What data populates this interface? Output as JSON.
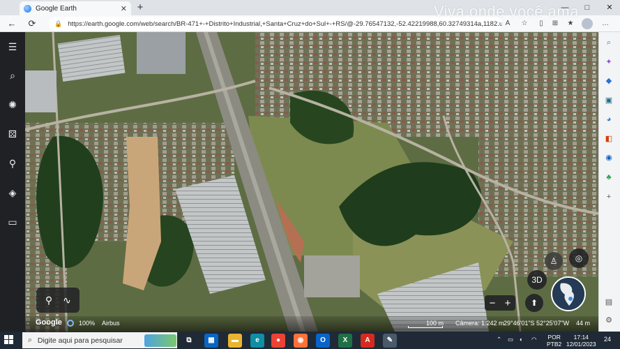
{
  "browser": {
    "tab_title": "Google Earth",
    "tab_close": "✕",
    "new_tab": "+",
    "window_controls": [
      "—",
      "□",
      "✕"
    ],
    "watermark": "Viva onde você ama",
    "back": "←",
    "refresh": "⟳",
    "url": "https://earth.google.com/web/search/BR-471+-+Distrito+Industrial,+Santa+Cruz+do+Sul+-+RS/@-29.76547132,-52.42219988,60.32749314a,1182.u38..."
  },
  "earth": {
    "rail_icons": [
      "menu-icon",
      "search-icon",
      "voyager-icon",
      "dice-icon",
      "pin-icon",
      "layers-icon",
      "ruler-icon"
    ],
    "btn_3d": "3D",
    "zoom_minus": "−",
    "zoom_plus": "+",
    "status": {
      "brand": "Google",
      "percent": "100%",
      "provider": "Airbus",
      "scale": "100 m",
      "camera": "Câmera: 1.242 m",
      "coords": "29°46'01\"S 52°25'07\"W",
      "elevation": "44 m"
    }
  },
  "taskbar": {
    "search_placeholder": "Digite aqui para pesquisar",
    "lang": "POR",
    "layout": "PTB2",
    "time": "17:14",
    "date": "12/01/2023",
    "notifications": "24",
    "apps": [
      {
        "name": "task-view",
        "label": "⧉",
        "color": "#1f2a36"
      },
      {
        "name": "store",
        "label": "▦",
        "color": "#0b66c2"
      },
      {
        "name": "explorer",
        "label": "▬",
        "color": "#e9b530"
      },
      {
        "name": "edge",
        "label": "e",
        "color": "#0f8ea4"
      },
      {
        "name": "chrome",
        "label": "●",
        "color": "#ea4335"
      },
      {
        "name": "firefox",
        "label": "◉",
        "color": "#ff7139"
      },
      {
        "name": "outlook",
        "label": "O",
        "color": "#0a64c8"
      },
      {
        "name": "excel",
        "label": "X",
        "color": "#1e7145"
      },
      {
        "name": "acrobat",
        "label": "A",
        "color": "#d52b1e"
      },
      {
        "name": "photos",
        "label": "✎",
        "color": "#4a5a6a"
      }
    ]
  }
}
